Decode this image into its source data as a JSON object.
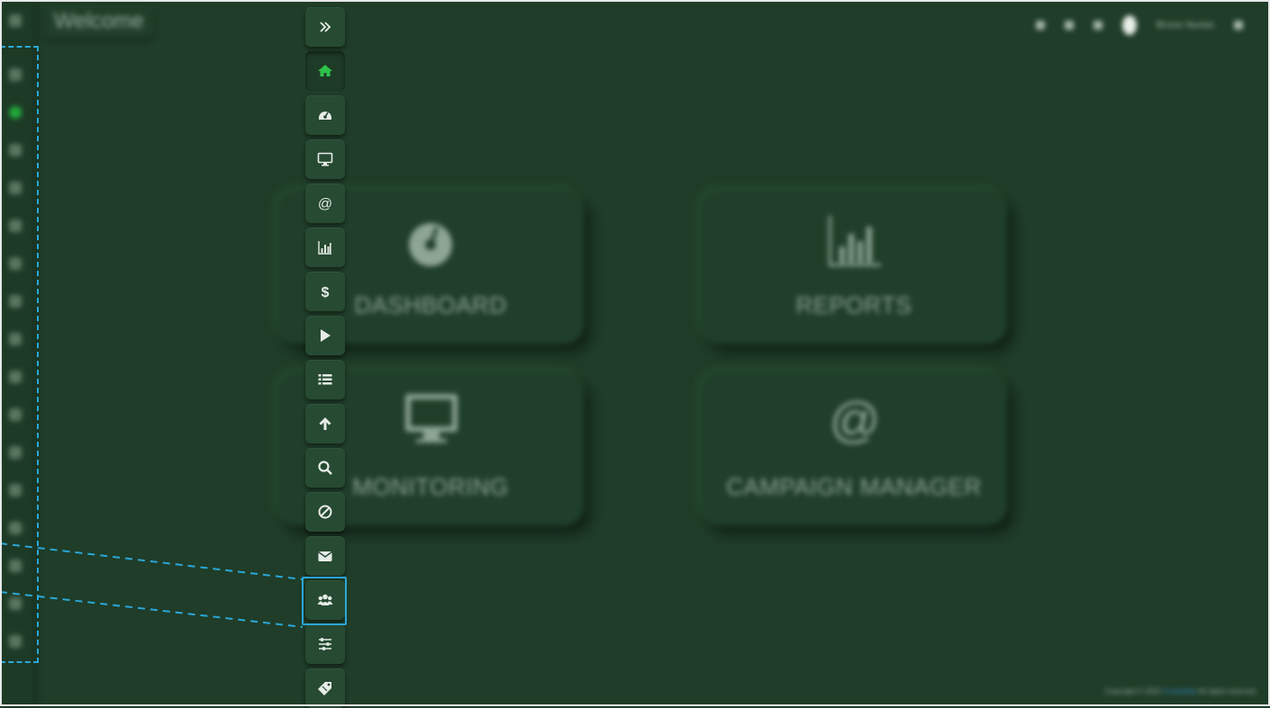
{
  "header": {
    "title": "Welcome",
    "user_name": "Bruno Nunes"
  },
  "tiles": [
    {
      "label": "DASHBOARD",
      "icon": "speedometer-icon"
    },
    {
      "label": "REPORTS",
      "icon": "bar-chart-icon"
    },
    {
      "label": "MONITORING",
      "icon": "monitor-icon"
    },
    {
      "label": "CAMPAIGN MANAGER",
      "icon": "at-sign-icon"
    }
  ],
  "sidebar": {
    "items": [
      {
        "name": "expand",
        "icon": "double-chevron-right-icon"
      },
      {
        "name": "home",
        "icon": "home-icon",
        "active": true
      },
      {
        "name": "dashboard",
        "icon": "speedometer-icon"
      },
      {
        "name": "monitoring",
        "icon": "monitor-icon"
      },
      {
        "name": "campaign-manager",
        "icon": "at-sign-icon"
      },
      {
        "name": "reports",
        "icon": "bar-chart-icon"
      },
      {
        "name": "billing",
        "icon": "dollar-icon"
      },
      {
        "name": "play",
        "icon": "play-icon"
      },
      {
        "name": "list",
        "icon": "list-icon"
      },
      {
        "name": "upload",
        "icon": "arrow-up-icon"
      },
      {
        "name": "search",
        "icon": "search-icon"
      },
      {
        "name": "blocked",
        "icon": "ban-icon"
      },
      {
        "name": "mail",
        "icon": "envelope-icon"
      },
      {
        "name": "users",
        "icon": "users-icon",
        "highlighted": true
      },
      {
        "name": "settings",
        "icon": "sliders-icon"
      },
      {
        "name": "tags",
        "icon": "tag-icon"
      }
    ]
  },
  "footer": {
    "prefix": "Copyright © 2023",
    "brand": "CrossSale",
    "suffix": "All rights reserved."
  },
  "colors": {
    "background": "#1f3d28",
    "accent": "#1faa3a",
    "highlight": "#2aa7d8"
  }
}
